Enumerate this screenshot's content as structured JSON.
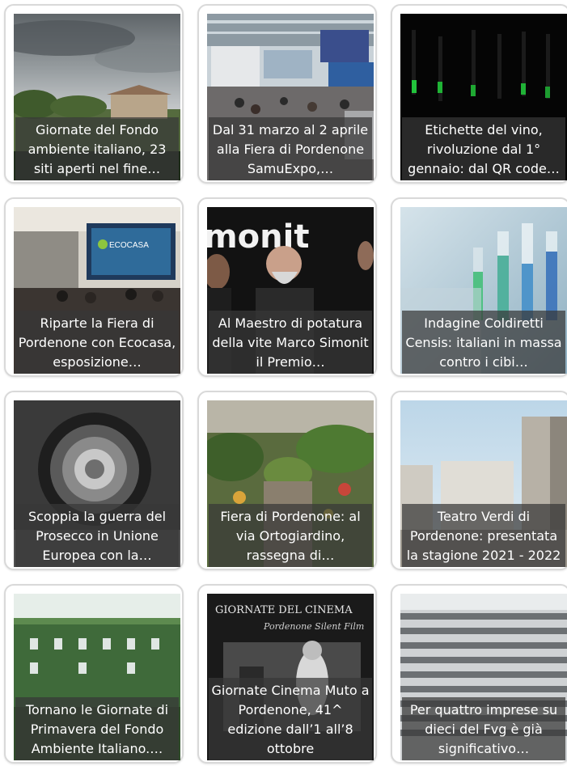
{
  "articles": [
    {
      "title": "Giornate del Fondo ambiente italiano, 23 siti aperti nel fine…",
      "image": "cloudy-sky-villa"
    },
    {
      "title": "Dal 31 marzo al 2 aprile alla Fiera di Pordenone SamuExpo,…",
      "image": "expo-hall"
    },
    {
      "title": "Etichette del vino, rivoluzione dal 1° gennaio: dal QR code…",
      "image": "wine-bottles"
    },
    {
      "title": "Riparte la Fiera di Pordenone con Ecocasa, esposizione…",
      "image": "conference-room",
      "screen_text": "ECOCASA"
    },
    {
      "title": "Al Maestro di potatura della vite Marco Simonit il Premio…",
      "image": "bearded-man",
      "sign_text": "monit"
    },
    {
      "title": "Indagine Coldiretti Censis: italiani in massa contro i cibi…",
      "image": "lab-tubes"
    },
    {
      "title": "Scoppia la guerra del Prosecco in Unione Europea con la…",
      "image": "wine-glass-bw"
    },
    {
      "title": "Fiera di Pordenone: al via Ortogiardino, rassegna di…",
      "image": "garden-fair"
    },
    {
      "title": "Teatro Verdi di Pordenone: presentata la stagione 2021 - 2022",
      "image": "theatre-building"
    },
    {
      "title": "Tornano le Giornate di Primavera del Fondo Ambiente Italiano.…",
      "image": "ivy-villa"
    },
    {
      "title": "Giornate Cinema Muto a Pordenone, 41^ edizione dall’1 all’8 ottobre",
      "image": "silent-cinema",
      "poster_text": "GIORNATE DEL CINEMA",
      "poster_sub": "Pordenone Silent Film"
    },
    {
      "title": "Per quattro imprese su dieci del Fvg è già significativo…",
      "image": "office-building"
    }
  ]
}
